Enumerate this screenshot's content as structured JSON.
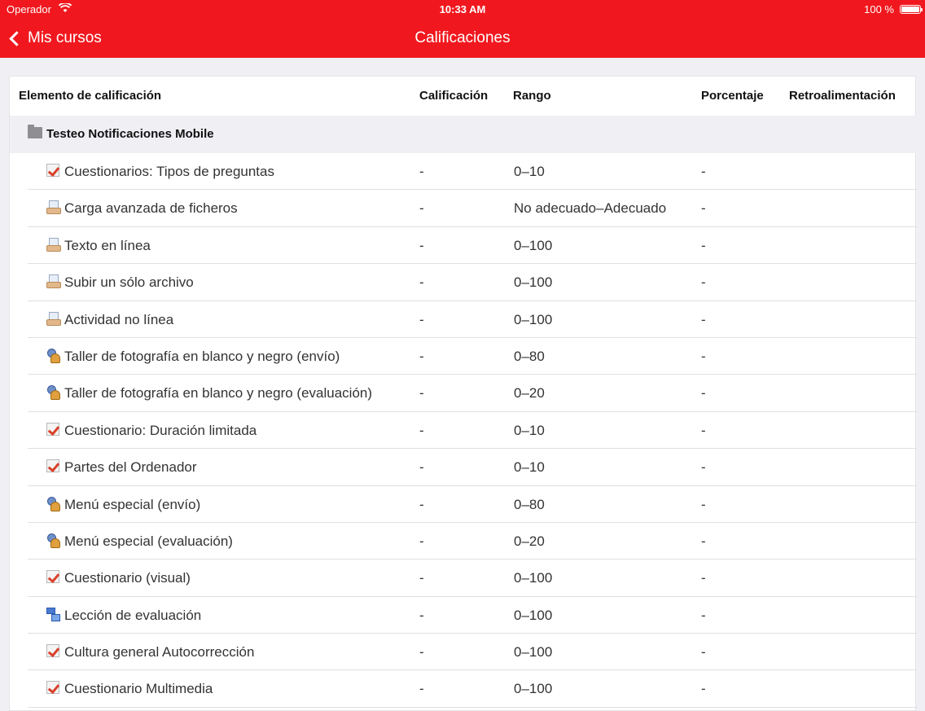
{
  "status_bar": {
    "carrier": "Operador",
    "time": "10:33 AM",
    "battery": "100 %"
  },
  "nav": {
    "back_label": "Mis cursos",
    "title": "Calificaciones"
  },
  "table": {
    "headers": {
      "item": "Elemento de calificación",
      "grade": "Calificación",
      "range": "Rango",
      "percentage": "Porcentaje",
      "feedback": "Retroalimentación"
    },
    "category": "Testeo Notificaciones Mobile",
    "rows": [
      {
        "icon": "quiz-icon",
        "item": "Cuestionarios: Tipos de preguntas",
        "grade": "-",
        "range": "0–10",
        "percentage": "-",
        "feedback": ""
      },
      {
        "icon": "assignment-icon",
        "item": "Carga avanzada de ficheros",
        "grade": "-",
        "range": "No adecuado–Adecuado",
        "percentage": "-",
        "feedback": ""
      },
      {
        "icon": "assignment-icon",
        "item": "Texto en línea",
        "grade": "-",
        "range": "0–100",
        "percentage": "-",
        "feedback": ""
      },
      {
        "icon": "assignment-icon",
        "item": "Subir un sólo archivo",
        "grade": "-",
        "range": "0–100",
        "percentage": "-",
        "feedback": ""
      },
      {
        "icon": "assignment-icon",
        "item": "Actividad no línea",
        "grade": "-",
        "range": "0–100",
        "percentage": "-",
        "feedback": ""
      },
      {
        "icon": "workshop-icon",
        "item": "Taller de fotografía en blanco y negro (envío)",
        "grade": "-",
        "range": "0–80",
        "percentage": "-",
        "feedback": ""
      },
      {
        "icon": "workshop-icon",
        "item": "Taller de fotografía en blanco y negro (evaluación)",
        "grade": "-",
        "range": "0–20",
        "percentage": "-",
        "feedback": ""
      },
      {
        "icon": "quiz-icon",
        "item": "Cuestionario: Duración limitada",
        "grade": "-",
        "range": "0–10",
        "percentage": "-",
        "feedback": ""
      },
      {
        "icon": "quiz-icon",
        "item": "Partes del Ordenador",
        "grade": "-",
        "range": "0–10",
        "percentage": "-",
        "feedback": ""
      },
      {
        "icon": "workshop-icon",
        "item": "Menú especial (envío)",
        "grade": "-",
        "range": "0–80",
        "percentage": "-",
        "feedback": ""
      },
      {
        "icon": "workshop-icon",
        "item": "Menú especial (evaluación)",
        "grade": "-",
        "range": "0–20",
        "percentage": "-",
        "feedback": ""
      },
      {
        "icon": "quiz-icon",
        "item": "Cuestionario (visual)",
        "grade": "-",
        "range": "0–100",
        "percentage": "-",
        "feedback": ""
      },
      {
        "icon": "lesson-icon",
        "item": "Lección de evaluación",
        "grade": "-",
        "range": "0–100",
        "percentage": "-",
        "feedback": ""
      },
      {
        "icon": "quiz-icon",
        "item": "Cultura general Autocorrección",
        "grade": "-",
        "range": "0–100",
        "percentage": "-",
        "feedback": ""
      },
      {
        "icon": "quiz-icon",
        "item": "Cuestionario Multimedia",
        "grade": "-",
        "range": "0–100",
        "percentage": "-",
        "feedback": ""
      }
    ]
  },
  "colors": {
    "header_bg": "#f0181e",
    "page_bg": "#efeff4"
  }
}
